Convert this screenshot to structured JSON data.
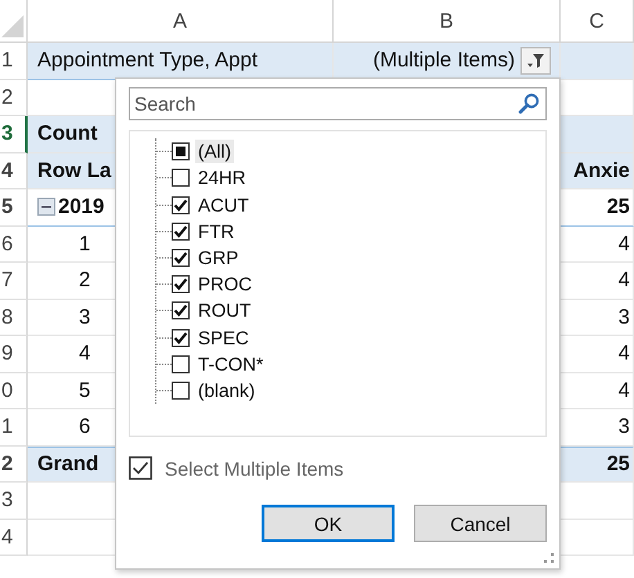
{
  "columns": [
    "A",
    "B",
    "C"
  ],
  "rows": [
    {
      "num": "1",
      "kind": "filter",
      "a": "Appointment Type, Appt",
      "b": "(Multiple Items)"
    },
    {
      "num": "2",
      "kind": "blank"
    },
    {
      "num": "3",
      "kind": "header",
      "a": "Count"
    },
    {
      "num": "4",
      "kind": "header",
      "a": "Row La",
      "c": "Anxie"
    },
    {
      "num": "5",
      "kind": "year",
      "a": "2019",
      "c": "25",
      "expanded": true
    },
    {
      "num": "6",
      "kind": "data",
      "a": "1",
      "c": "4"
    },
    {
      "num": "7",
      "kind": "data",
      "a": "2",
      "c": "4"
    },
    {
      "num": "8",
      "kind": "data",
      "a": "3",
      "c": "3"
    },
    {
      "num": "9",
      "kind": "data",
      "a": "4",
      "c": "4"
    },
    {
      "num": "0",
      "kind": "data",
      "a": "5",
      "c": "4"
    },
    {
      "num": "1",
      "kind": "data",
      "a": "6",
      "c": "3"
    },
    {
      "num": "2",
      "kind": "total",
      "a": "Grand",
      "c": "25"
    },
    {
      "num": "3",
      "kind": "blank"
    },
    {
      "num": "4",
      "kind": "blank"
    }
  ],
  "filter_popup": {
    "search": {
      "placeholder": "Search"
    },
    "items": [
      {
        "label": "(All)",
        "checked": false,
        "mixed": true,
        "selected": true
      },
      {
        "label": "24HR",
        "checked": false,
        "mixed": false,
        "selected": false
      },
      {
        "label": "ACUT",
        "checked": true,
        "mixed": false,
        "selected": false
      },
      {
        "label": "FTR",
        "checked": true,
        "mixed": false,
        "selected": false
      },
      {
        "label": "GRP",
        "checked": true,
        "mixed": false,
        "selected": false
      },
      {
        "label": "PROC",
        "checked": true,
        "mixed": false,
        "selected": false
      },
      {
        "label": "ROUT",
        "checked": true,
        "mixed": false,
        "selected": false
      },
      {
        "label": "SPEC",
        "checked": true,
        "mixed": false,
        "selected": false
      },
      {
        "label": "T-CON*",
        "checked": false,
        "mixed": false,
        "selected": false
      },
      {
        "label": "(blank)",
        "checked": false,
        "mixed": false,
        "selected": false
      }
    ],
    "select_multiple": {
      "label": "Select Multiple Items",
      "checked": true
    },
    "buttons": [
      {
        "label": "OK",
        "default": true
      },
      {
        "label": "Cancel",
        "default": false
      }
    ]
  }
}
